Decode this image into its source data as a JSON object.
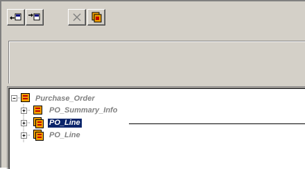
{
  "toolbar": {
    "buttons": [
      {
        "name": "move-left-button",
        "icon": "arrow-left-block-icon"
      },
      {
        "name": "move-right-button",
        "icon": "arrow-right-block-icon"
      },
      {
        "name": "delete-button",
        "icon": "x-delete-icon"
      },
      {
        "name": "copy-button",
        "icon": "stacked-pages-icon"
      }
    ]
  },
  "tree": {
    "root": {
      "label": "Purchase_Order",
      "expander": "minus"
    },
    "children": [
      {
        "label": "PO_Summary_Info",
        "expander": "plus",
        "selected": false
      },
      {
        "label": "PO_Line",
        "expander": "plus",
        "selected": true
      },
      {
        "label": "PO_Line",
        "expander": "plus",
        "selected": false
      }
    ]
  },
  "colors": {
    "panel": "#d4d0c8",
    "selection": "#0a246a",
    "icon_orange": "#f0a000",
    "icon_red": "#c00000"
  }
}
